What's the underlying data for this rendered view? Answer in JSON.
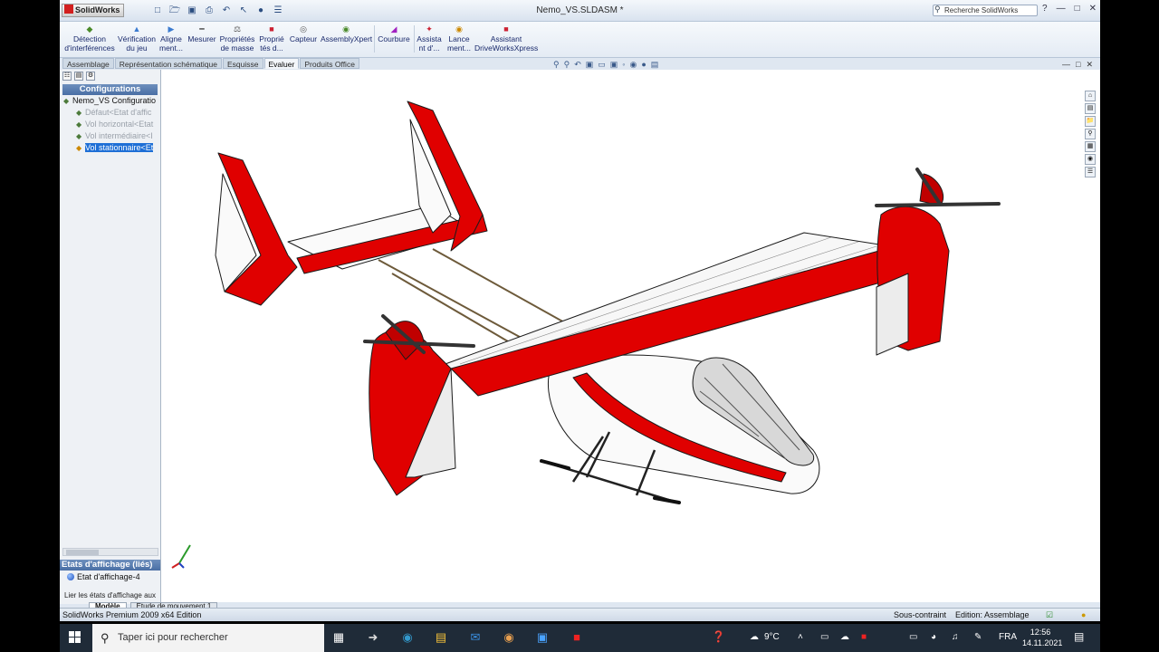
{
  "app": {
    "logo": "SolidWorks",
    "document_title": "Nemo_VS.SLDASM *",
    "search_placeholder": "Recherche SolidWorks"
  },
  "ribbon": {
    "buttons": [
      {
        "line1": "Détection",
        "line2": "d'interférences",
        "icon": "interference-icon"
      },
      {
        "line1": "Vérification",
        "line2": "du jeu",
        "icon": "clearance-icon"
      },
      {
        "line1": "Aligne",
        "line2": "ment...",
        "icon": "align-icon"
      },
      {
        "line1": "Mesurer",
        "line2": "",
        "icon": "measure-icon"
      },
      {
        "line1": "Propriétés",
        "line2": "de masse",
        "icon": "mass-properties-icon"
      },
      {
        "line1": "Proprié",
        "line2": "tés d...",
        "icon": "section-properties-icon"
      },
      {
        "line1": "Capteur",
        "line2": "",
        "icon": "sensor-icon"
      },
      {
        "line1": "AssemblyXpert",
        "line2": "",
        "icon": "assemblyxpert-icon"
      },
      {
        "line1": "Courbure",
        "line2": "",
        "icon": "curvature-icon"
      },
      {
        "line1": "Assista",
        "line2": "nt d'...",
        "icon": "assistant-icon"
      },
      {
        "line1": "Lance",
        "line2": "ment...",
        "icon": "launch-icon"
      },
      {
        "line1": "Assistant",
        "line2": "DriveWorksXpress",
        "icon": "driveworks-icon"
      }
    ]
  },
  "tabs": [
    {
      "label": "Assemblage",
      "active": false
    },
    {
      "label": "Représentation schématique",
      "active": false
    },
    {
      "label": "Esquisse",
      "active": false
    },
    {
      "label": "Evaluer",
      "active": true
    },
    {
      "label": "Produits Office",
      "active": false
    }
  ],
  "panel": {
    "header": "Configurations",
    "root": "Nemo_VS Configuration",
    "items": [
      {
        "label": "Défaut<Etat d'affic",
        "state": "dim"
      },
      {
        "label": "Vol horizontal<Etat",
        "state": "dim"
      },
      {
        "label": "Vol intermédiaire<I",
        "state": "dim"
      },
      {
        "label": "Vol stationnaire<Et",
        "state": "selected"
      }
    ],
    "display_states_header": "Etats d'affichage (liés)",
    "display_state_item": "Etat d'affichage-4",
    "link_text": "Lier les états d'affichage aux"
  },
  "bottom_tabs": [
    {
      "label": "Modèle",
      "active": true
    },
    {
      "label": "Etude de mouvement 1",
      "active": false
    }
  ],
  "status": {
    "edition": "SolidWorks Premium 2009 x64 Edition",
    "constraint": "Sous-contraint",
    "mode": "Edition: Assemblage"
  },
  "taskbar": {
    "search_placeholder": "Taper ici pour rechercher",
    "weather": "9°C",
    "language": "FRA",
    "time": "12:56",
    "date": "14.11.2021"
  },
  "colors": {
    "accent_red": "#e00000",
    "panel_header": "#4a6fa5",
    "selection": "#1e6fd6"
  }
}
